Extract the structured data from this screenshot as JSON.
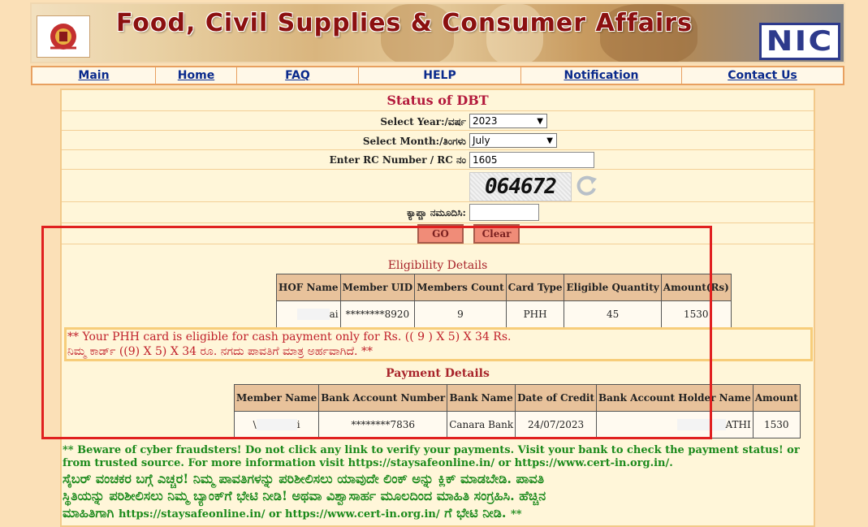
{
  "header": {
    "title": "Food, Civil Supplies & Consumer Affairs",
    "emblem_icon": "karnataka-emblem-icon",
    "nic_logo_text": "NIC"
  },
  "nav": {
    "items": [
      {
        "label": "Main",
        "link": true
      },
      {
        "label": "Home",
        "link": true
      },
      {
        "label": "FAQ",
        "link": true
      },
      {
        "label": "HELP",
        "link": false
      },
      {
        "label": "Notification",
        "link": true
      },
      {
        "label": "Contact Us",
        "link": true
      }
    ]
  },
  "form": {
    "title": "Status of DBT",
    "year_label": "Select Year:/ವರ್ಷ",
    "year_value": "2023",
    "month_label": "Select Month:/ತಿಂಗಳು",
    "month_value": "July",
    "rc_label": "Enter RC Number  / RC ನಂ",
    "rc_value": "1605",
    "captcha_text": "064672",
    "captcha_label": "ಕ್ಯಾಪ್ಚಾ ನಮೂದಿಸಿ:",
    "captcha_value": "",
    "go_label": "GO",
    "clear_label": "Clear"
  },
  "eligibility": {
    "title": "Eligibility Details",
    "headers": [
      "HOF Name",
      "Member UID",
      "Members Count",
      "Card Type",
      "Eligible Quantity",
      "Amount(Rs)"
    ],
    "row": [
      "ai",
      "********8920",
      "9",
      "PHH",
      "45",
      "1530"
    ]
  },
  "notice": {
    "line1": "** Your PHH card is eligible for cash payment only for Rs. (( 9 ) X 5) X 34 Rs.",
    "line2": "ನಿಮ್ಮ ಕಾರ್ಡ್ ((9) X 5) X 34 ರೂ. ನಗದು ಪಾವತಿಗೆ ಮಾತ್ರ ಅರ್ಹವಾಗಿದೆ. **"
  },
  "payment": {
    "title": "Payment Details",
    "headers": [
      "Member Name",
      "Bank Account Number",
      "Bank Name",
      "Date of Credit",
      "Bank Account Holder Name",
      "Amount"
    ],
    "row": [
      "\\",
      "i",
      "********7836",
      "Canara Bank",
      "24/07/2023",
      "ATHI",
      "1530"
    ]
  },
  "warning": {
    "en": "** Beware of cyber fraudsters! Do not click any link to verify your payments. Visit your bank to check the payment status! or from trusted source. For more information visit https://staysafeonline.in/ or https://www.cert-in.org.in/.",
    "kn1": "ಸೈಬರ್ ವಂಚಕರ ಬಗ್ಗೆ ಎಚ್ಚರ! ನಿಮ್ಮ ಪಾವತಿಗಳನ್ನು ಪರಿಶೀಲಿಸಲು ಯಾವುದೇ ಲಿಂಕ್ ಅನ್ನು ಕ್ಲಿಕ್ ಮಾಡಬೇಡಿ. ಪಾವತಿ",
    "kn2": "ಸ್ಥಿತಿಯನ್ನು ಪರಿಶೀಲಿಸಲು ನಿಮ್ಮ ಬ್ಯಾಂಕ್‌ಗೆ ಭೇಟಿ ನೀಡಿ! ಅಥವಾ ವಿಶ್ವಾಸಾರ್ಹ ಮೂಲದಿಂದ ಮಾಹಿತಿ ಸಂಗ್ರಹಿಸಿ. ಹೆಚ್ಚಿನ",
    "kn3a": "ಮಾಹಿತಿಗಾಗಿ",
    "kn3b": "https://staysafeonline.in/ or https://www.cert-in.org.in/",
    "kn3c": "ಗೆ ಭೇಟಿ ನೀಡಿ.",
    "kn3d": "**"
  },
  "colors": {
    "page_bg": "#fbe0b7",
    "title_red": "#b3193c",
    "nav_link": "#0a2a8c",
    "warning_green": "#1c8a1c",
    "highlight_box": "#e02020"
  }
}
